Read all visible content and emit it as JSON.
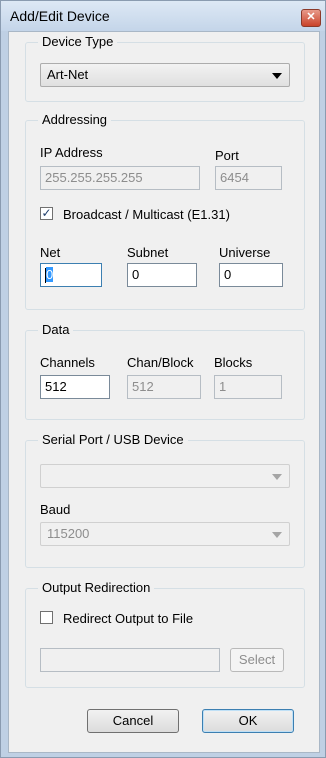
{
  "window": {
    "title": "Add/Edit Device",
    "close_label": "✕"
  },
  "device_type": {
    "group_title": "Device Type",
    "selected": "Art-Net"
  },
  "addressing": {
    "group_title": "Addressing",
    "ip_label": "IP Address",
    "ip_value": "255.255.255.255",
    "port_label": "Port",
    "port_value": "6454",
    "broadcast_label": "Broadcast / Multicast (E1.31)",
    "broadcast_checked": true,
    "checkmark": "✓",
    "net_label": "Net",
    "net_value": "0",
    "subnet_label": "Subnet",
    "subnet_value": "0",
    "universe_label": "Universe",
    "universe_value": "0"
  },
  "data": {
    "group_title": "Data",
    "channels_label": "Channels",
    "channels_value": "512",
    "chan_block_label": "Chan/Block",
    "chan_block_value": "512",
    "blocks_label": "Blocks",
    "blocks_value": "1"
  },
  "serial": {
    "group_title": "Serial Port / USB Device",
    "port_selected": "",
    "baud_label": "Baud",
    "baud_selected": "115200"
  },
  "output": {
    "group_title": "Output Redirection",
    "redirect_label": "Redirect Output to File",
    "redirect_checked": false,
    "file_path": "",
    "select_label": "Select"
  },
  "buttons": {
    "cancel_label": "Cancel",
    "ok_label": "OK"
  }
}
